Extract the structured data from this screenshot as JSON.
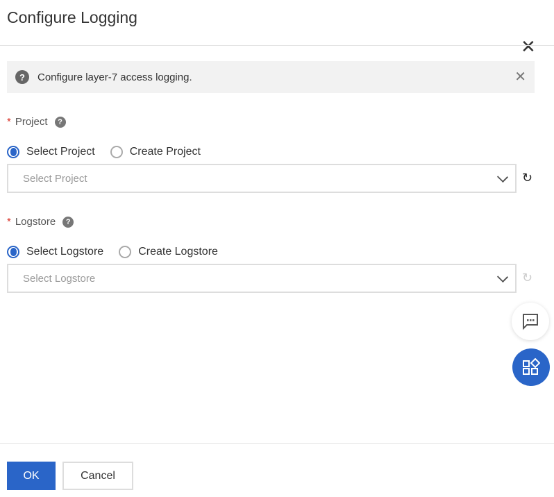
{
  "dialog": {
    "title": "Configure Logging"
  },
  "notice": {
    "text": "Configure layer-7 access logging."
  },
  "project": {
    "label": "Project",
    "options": [
      "Select Project",
      "Create Project"
    ],
    "selected": "Select Project",
    "placeholder": "Select Project"
  },
  "logstore": {
    "label": "Logstore",
    "options": [
      "Select Logstore",
      "Create Logstore"
    ],
    "selected": "Select Logstore",
    "placeholder": "Select Logstore"
  },
  "footer": {
    "ok": "OK",
    "cancel": "Cancel"
  },
  "colors": {
    "primary": "#2a65c8",
    "required": "#d93026"
  }
}
